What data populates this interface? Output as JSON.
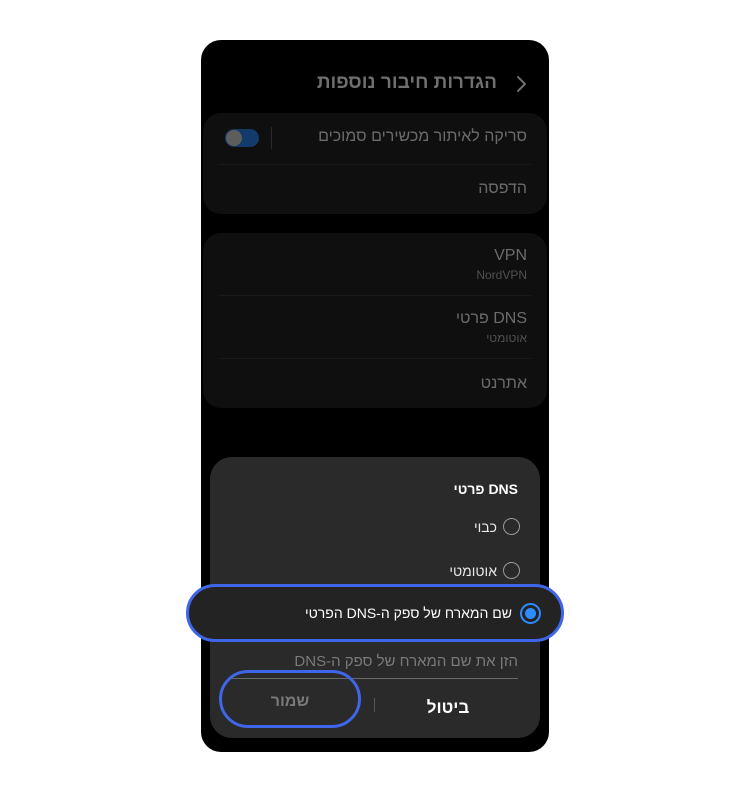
{
  "header": {
    "title": "הגדרות חיבור נוספות"
  },
  "section1": {
    "items": [
      {
        "label": "סריקה לאיתור מכשירים סמוכים"
      },
      {
        "label": "הדפסה"
      }
    ]
  },
  "section2": {
    "items": [
      {
        "label": "VPN",
        "sub": "NordVPN"
      },
      {
        "label": "DNS פרטי",
        "sub": "אוטומטי"
      },
      {
        "label": "אתרנט"
      }
    ]
  },
  "dialog": {
    "title": "DNS פרטי",
    "options": [
      {
        "label": "כבוי"
      },
      {
        "label": "אוטומטי"
      },
      {
        "label": "שם המארח של ספק ה-DNS הפרטי"
      }
    ],
    "selected_index": 2,
    "host_placeholder": "הזן את שם המארח של ספק ה-DNS",
    "cancel_label": "ביטול",
    "save_label": "שמור"
  },
  "colors": {
    "highlight": "#3f66e8",
    "accent": "#2d8cff"
  }
}
